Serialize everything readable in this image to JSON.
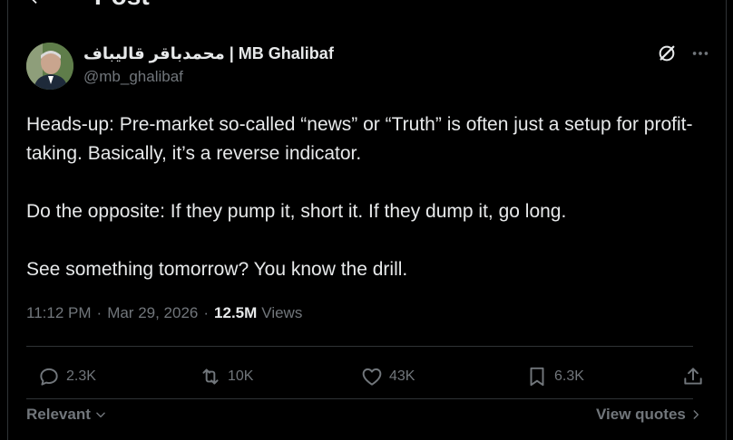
{
  "header": {
    "title": "Post"
  },
  "author": {
    "name": "محمدباقر قالیباف | MB Ghalibaf",
    "handle": "@mb_ghalibaf"
  },
  "post": {
    "paragraphs": [
      "Heads-up: Pre-market so-called “news” or “Truth” is often just a setup for profit-taking. Basically, it’s a reverse indicator.",
      "Do the opposite: If they pump it, short it. If they dump it, go long.",
      "See something tomorrow? You know the drill."
    ],
    "time": "11:12 PM",
    "date": "Mar 29, 2026",
    "separator": "·",
    "views_count": "12.5M",
    "views_label": "Views"
  },
  "actions": {
    "replies": "2.3K",
    "reposts": "10K",
    "likes": "43K",
    "bookmarks": "6.3K"
  },
  "footer": {
    "relevant_label": "Relevant",
    "view_quotes_label": "View quotes"
  },
  "icons": {
    "back": "back-arrow-icon",
    "grok": "grok-icon",
    "more": "more-icon",
    "reply": "reply-icon",
    "repost": "repost-icon",
    "like": "heart-icon",
    "bookmark": "bookmark-icon",
    "share": "share-icon"
  },
  "colors": {
    "background": "#000000",
    "text": "#e7e9ea",
    "muted": "#71767b",
    "divider": "#2f3336"
  }
}
